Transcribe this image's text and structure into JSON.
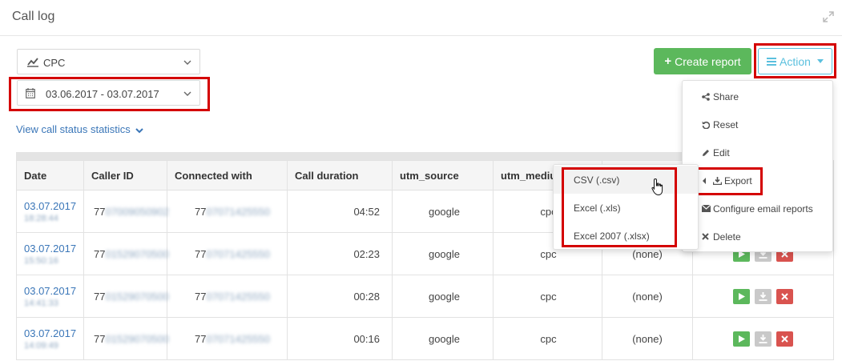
{
  "header": {
    "title": "Call log"
  },
  "filters": {
    "campaign": {
      "label": "CPC",
      "icon": "chart-line-icon"
    },
    "date_range": {
      "label": "03.06.2017 - 03.07.2017",
      "icon": "calendar-icon"
    }
  },
  "stats_link": {
    "label": "View call status statistics"
  },
  "toolbar": {
    "create_label": "Create report",
    "action_label": "Action"
  },
  "table": {
    "columns": [
      "Date",
      "Caller ID",
      "Connected with",
      "Call duration",
      "utm_source",
      "utm_mediur"
    ],
    "rows": [
      {
        "date": "03.07.2017",
        "time": "18:28:44",
        "caller": "77",
        "caller_hidden": "07009050902",
        "connected": "77",
        "connected_hidden": "07071425550",
        "duration": "04:52",
        "source": "google",
        "medium": "cpc",
        "campaign": ""
      },
      {
        "date": "03.07.2017",
        "time": "15:50:16",
        "caller": "77",
        "caller_hidden": "01529070500",
        "connected": "77",
        "connected_hidden": "07071425550",
        "duration": "02:23",
        "source": "google",
        "medium": "cpc",
        "campaign": "(none)"
      },
      {
        "date": "03.07.2017",
        "time": "14:41:33",
        "caller": "77",
        "caller_hidden": "01529070500",
        "connected": "77",
        "connected_hidden": "07071425550",
        "duration": "00:28",
        "source": "google",
        "medium": "cpc",
        "campaign": "(none)"
      },
      {
        "date": "03.07.2017",
        "time": "14:09:49",
        "caller": "77",
        "caller_hidden": "01529070500",
        "connected": "77",
        "connected_hidden": "07071425550",
        "duration": "00:16",
        "source": "google",
        "medium": "cpc",
        "campaign": "(none)"
      }
    ]
  },
  "action_menu": {
    "items": [
      {
        "label": "Share",
        "icon": "share-icon"
      },
      {
        "label": "Reset",
        "icon": "undo-icon"
      },
      {
        "label": "Edit",
        "icon": "pencil-icon"
      },
      {
        "label": "Export",
        "icon": "download-icon"
      },
      {
        "label": "Configure email reports",
        "icon": "envelope-icon"
      },
      {
        "label": "Delete",
        "icon": "close-icon"
      }
    ]
  },
  "export_menu": {
    "items": [
      {
        "label": "CSV (.csv)"
      },
      {
        "label": "Excel (.xls)"
      },
      {
        "label": "Excel 2007 (.xlsx)"
      }
    ]
  },
  "colors": {
    "green": "#5cb85c",
    "info": "#5bc0de",
    "link": "#3a76b8",
    "danger": "#d9534f",
    "highlight": "#d40000"
  }
}
